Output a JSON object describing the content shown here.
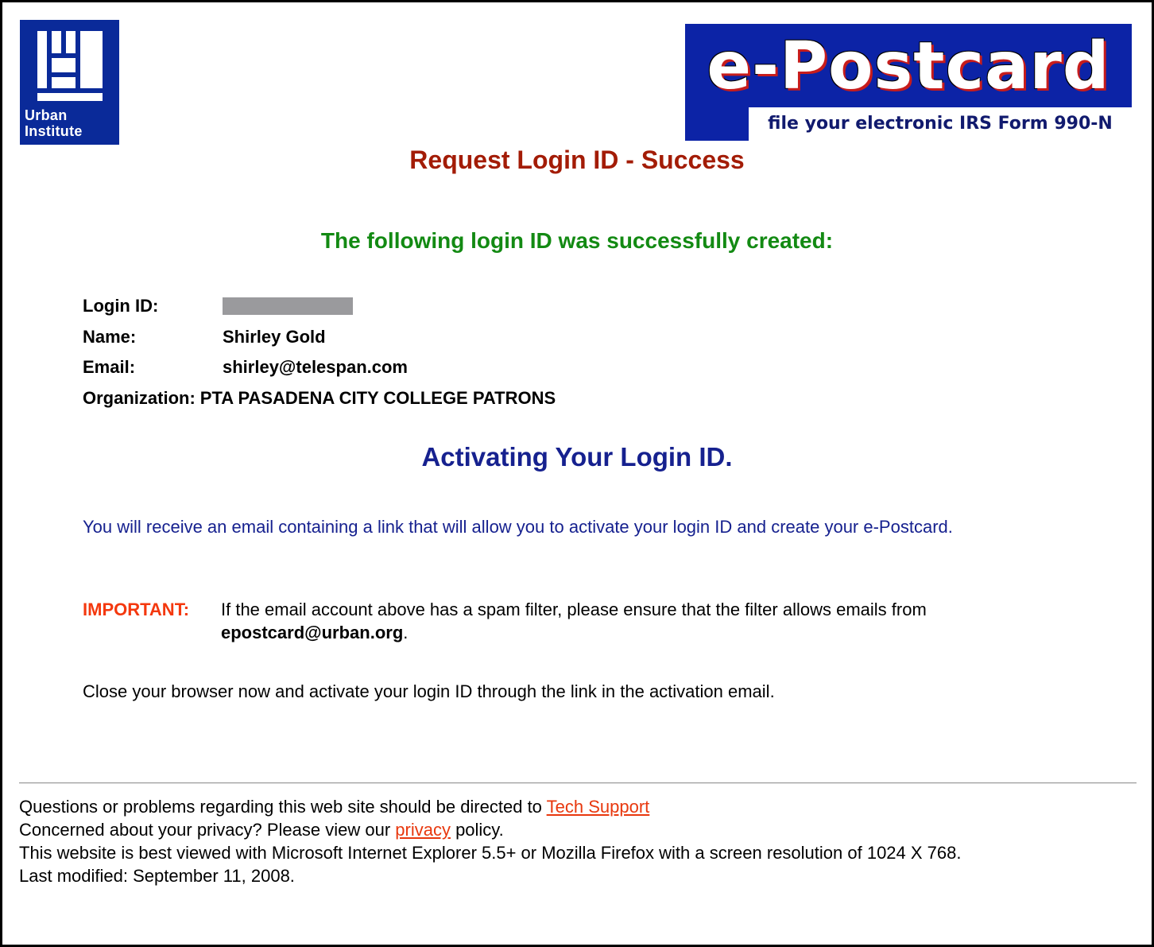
{
  "header": {
    "org_logo_line1": "Urban",
    "org_logo_line2": "Institute",
    "banner_title": "e-Postcard",
    "banner_subtitle": "file your electronic IRS Form 990-N"
  },
  "page": {
    "title": "Request Login ID - Success",
    "success_heading": "The following login ID was successfully created:"
  },
  "details": {
    "login_id_label": "Login ID:",
    "name_label": "Name:",
    "name_value": "Shirley Gold",
    "email_label": "Email:",
    "email_value": "shirley@telespan.com",
    "org_label": "Organization:",
    "org_value": "PTA PASADENA CITY COLLEGE PATRONS"
  },
  "activation": {
    "heading": "Activating Your Login ID.",
    "text": "You will receive an email containing a link that will allow you to activate your login ID and create your e-Postcard.",
    "important_label": "IMPORTANT:",
    "important_text_1": "If the email account above has a spam filter, please ensure that the filter allows emails from ",
    "important_email": "epostcard@urban.org",
    "important_text_2": ".",
    "close_text": "Close your browser now and activate your login ID through the link in the activation email."
  },
  "footer": {
    "line1_text": "Questions or problems regarding this web site should be directed to ",
    "tech_support_link": "Tech Support",
    "line2_text_a": "Concerned about your privacy? Please view our ",
    "privacy_link": "privacy",
    "line2_text_b": " policy.",
    "line3_text": "This website is best viewed with Microsoft Internet Explorer 5.5+ or Mozilla Firefox with a screen resolution of 1024 X 768.",
    "line4_text": "Last modified: September 11, 2008."
  },
  "colors": {
    "title": "#a31c06",
    "success": "#138a13",
    "activation": "#16218f",
    "important": "#f4380e",
    "link": "#e8380e"
  }
}
